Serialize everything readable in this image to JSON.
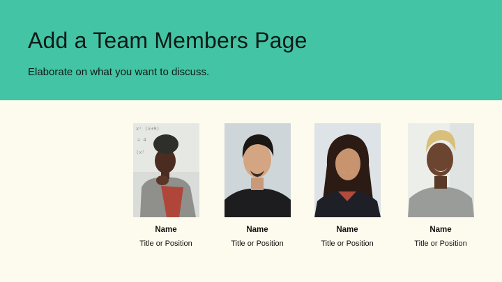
{
  "slide": {
    "title": "Add a Team Members Page",
    "subtitle": "Elaborate on what you want to discuss."
  },
  "members": [
    {
      "name": "Name",
      "position": "Title or Position",
      "photo": "portrait-photo"
    },
    {
      "name": "Name",
      "position": "Title or Position",
      "photo": "portrait-photo"
    },
    {
      "name": "Name",
      "position": "Title or Position",
      "photo": "portrait-photo"
    },
    {
      "name": "Name",
      "position": "Title or Position",
      "photo": "portrait-photo"
    }
  ],
  "colors": {
    "header_bg": "#43c4a4",
    "page_bg": "#fdfbed",
    "text": "#0e1a17"
  }
}
